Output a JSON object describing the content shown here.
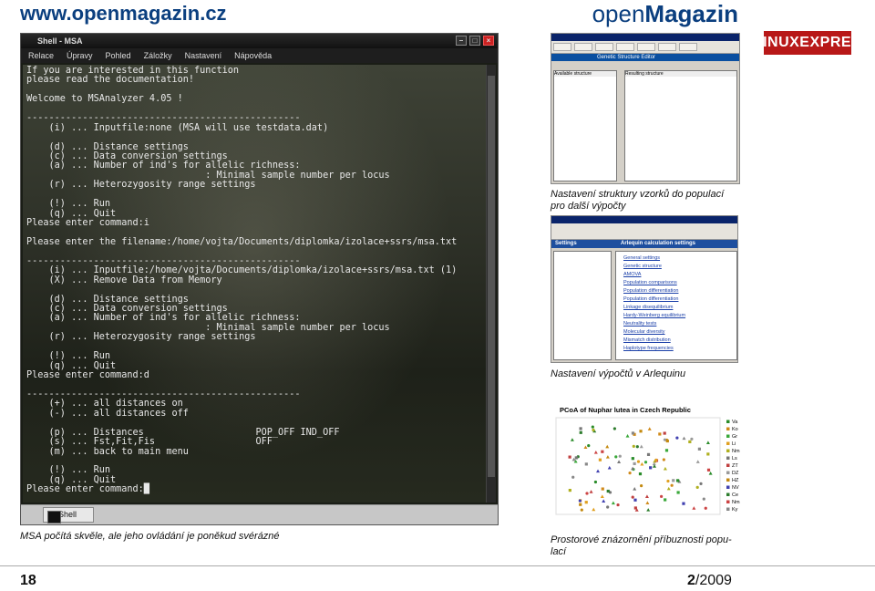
{
  "header": {
    "site_url": "www.openmagazin.cz",
    "brand_plain": "open",
    "brand_bold": "Magazin",
    "logo_text": "LINUXEXPRES"
  },
  "shell": {
    "title": "Shell - MSA",
    "menu": [
      "Relace",
      "Úpravy",
      "Pohled",
      "Záložky",
      "Nastavení",
      "Nápověda"
    ],
    "terminal_lines": [
      "If you are interested in this function",
      "please read the documentation!",
      "",
      "Welcome to MSAnalyzer 4.05 !",
      "",
      "-------------------------------------------------",
      "    (i) ... Inputfile:none (MSA will use testdata.dat)",
      "",
      "    (d) ... Distance settings",
      "    (c) ... Data conversion settings",
      "    (a) ... Number of ind's for allelic richness:",
      "                                : Minimal sample number per locus",
      "    (r) ... Heterozygosity range settings",
      "",
      "    (!) ... Run",
      "    (q) ... Quit",
      "Please enter command:i",
      "",
      "Please enter the filename:/home/vojta/Documents/diplomka/izolace+ssrs/msa.txt",
      "",
      "-------------------------------------------------",
      "    (i) ... Inputfile:/home/vojta/Documents/diplomka/izolace+ssrs/msa.txt (1)",
      "    (X) ... Remove Data from Memory",
      "",
      "    (d) ... Distance settings",
      "    (c) ... Data conversion settings",
      "    (a) ... Number of ind's for allelic richness:",
      "                                : Minimal sample number per locus",
      "    (r) ... Heterozygosity range settings",
      "",
      "    (!) ... Run",
      "    (q) ... Quit",
      "Please enter command:d",
      "",
      "-------------------------------------------------",
      "    (+) ... all distances on",
      "    (-) ... all distances off",
      "",
      "    (p) ... Distances                    POP_OFF IND_OFF",
      "    (s) ... Fst,Fit,Fis                  OFF",
      "    (m) ... back to main menu",
      "",
      "    (!) ... Run",
      "    (q) ... Quit",
      "Please enter command:█"
    ],
    "taskbar_button": "Shell"
  },
  "captions": {
    "shell": "MSA počítá skvěle, ale jeho ovládání je poněkud svérázné",
    "shot1_line1": "Nastavení struktury vzorků do populací",
    "shot1_line2": "pro další výpočty",
    "shot2": "Nastavení výpočtů v Arlequinu",
    "chart_line1": "Prostorové znázornění příbuznosti popu-",
    "chart_line2": "lací"
  },
  "shot1": {
    "panel_title": "Genetic Structure Editor",
    "left_group": "Available structure",
    "right_group": "Resulting structure"
  },
  "shot2": {
    "tab_left": "Settings",
    "tab_right": "Arlequin calculation settings",
    "links": [
      "General settings",
      "Genetic structure",
      "AMOVA",
      "Population comparisons",
      "Population differentiation",
      "Population differentiation",
      "Linkage disequilibrium",
      "Hardy-Weinberg equilibrium",
      "Neutrality tests",
      "Molecular diversity",
      "Mismatch distribution",
      "Haplotype frequencies"
    ]
  },
  "chart_data": {
    "type": "scatter",
    "title": "PCoA of Nuphar lutea in Czech Republic",
    "legend": [
      "Va",
      "Ko",
      "Gr",
      "Li",
      "Nm",
      "Ls",
      "ZT",
      "DZ",
      "HZ",
      "NV",
      "Ce",
      "Nm",
      "Ky"
    ],
    "legend_placement": "right",
    "colors": [
      "#2a8c2a",
      "#d08a1a",
      "#3aa83a",
      "#e0a020",
      "#b0b020",
      "#777",
      "#c04040",
      "#9a9a9a",
      "#c48a10",
      "#4040b0",
      "#2e7d2e",
      "#cc4444",
      "#888888"
    ]
  },
  "footer": {
    "page_number": "18",
    "issue_number": "2",
    "issue_rest": "/2009"
  }
}
